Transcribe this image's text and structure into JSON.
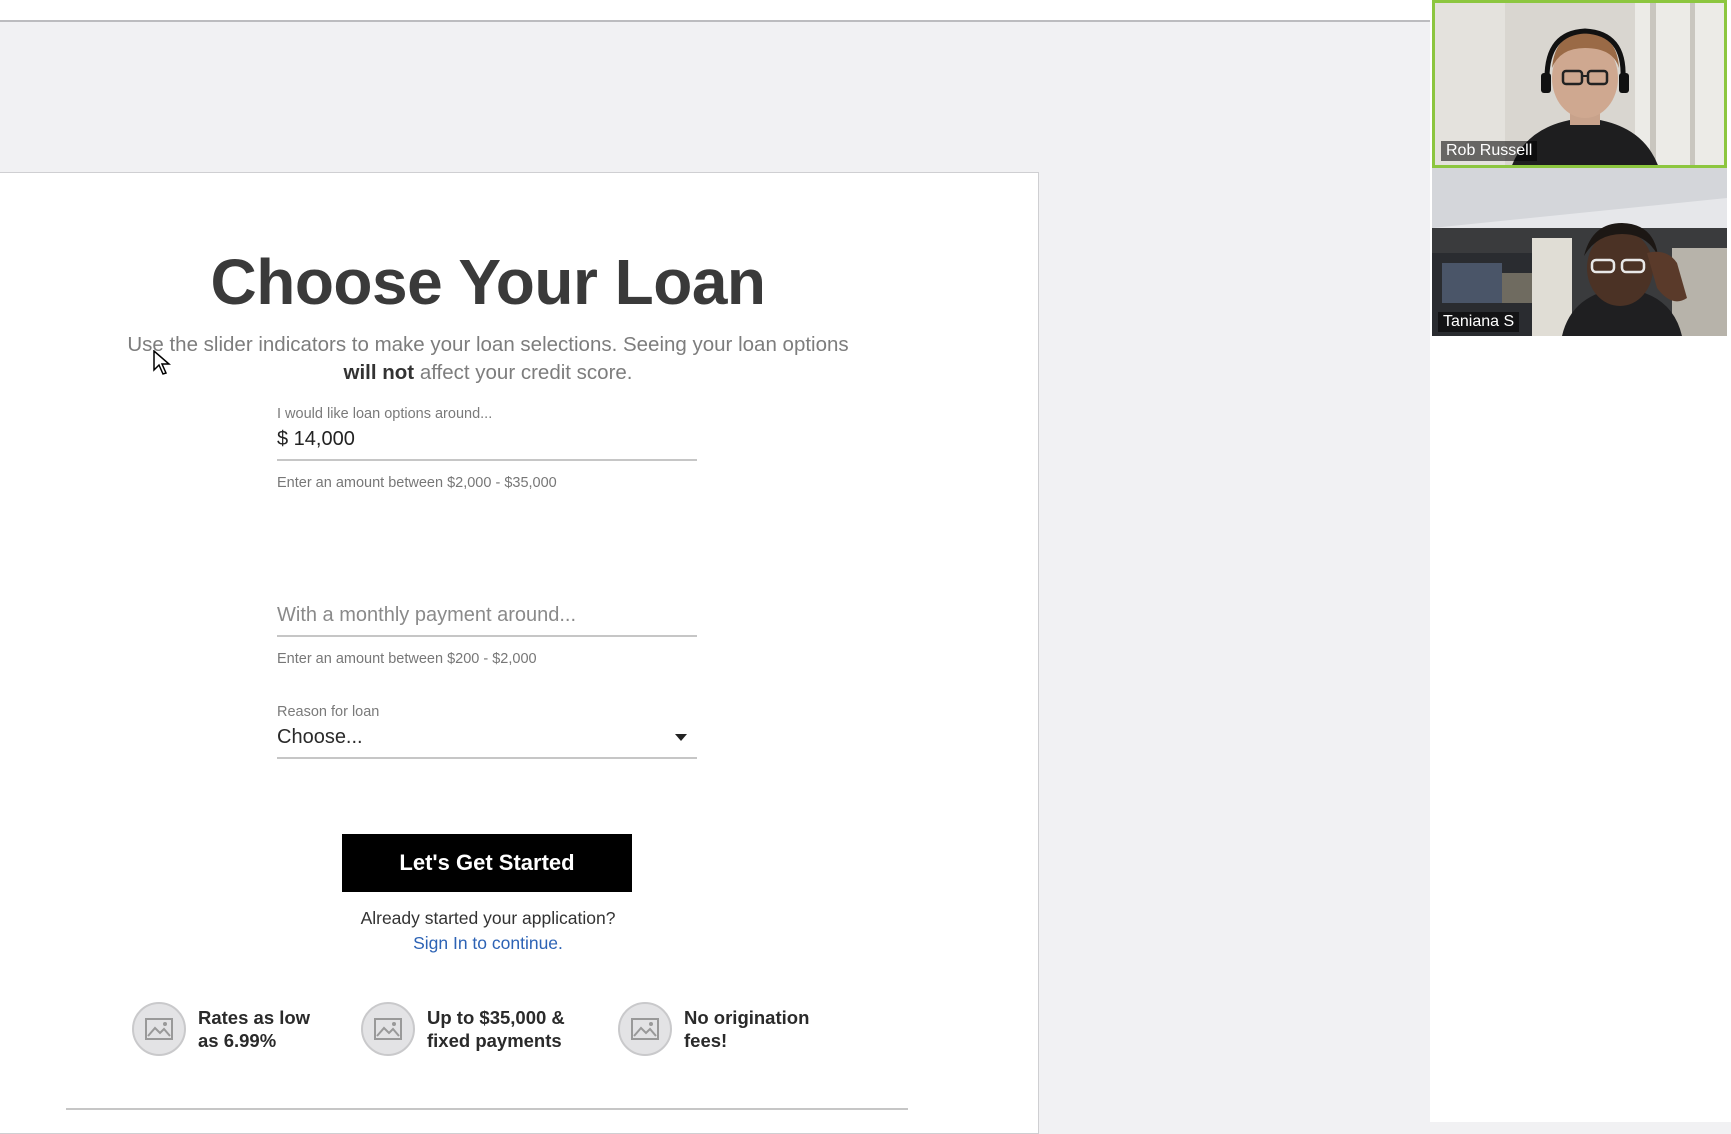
{
  "page": {
    "title": "Choose Your Loan",
    "subtitle_before": "Use the slider indicators to make your loan selections. Seeing your loan options",
    "subtitle_bold": "will not",
    "subtitle_after": "affect your credit score."
  },
  "loan_amount": {
    "label": "I would like loan options around...",
    "value": "$ 14,000",
    "hint": "Enter an amount between $2,000 - $35,000"
  },
  "monthly_payment": {
    "placeholder": "With a monthly payment around...",
    "value": "",
    "hint": "Enter an amount between $200 - $2,000"
  },
  "reason": {
    "label": "Reason for loan",
    "selected": "Choose..."
  },
  "cta": {
    "label": "Let's Get Started"
  },
  "signin": {
    "prompt": "Already started your application?",
    "link": "Sign In to continue."
  },
  "features": [
    {
      "line1": "Rates as low",
      "line2": "as 6.99%",
      "icon": "image-placeholder-icon"
    },
    {
      "line1": "Up to $35,000 &",
      "line2": "fixed payments",
      "icon": "image-placeholder-icon"
    },
    {
      "line1": "No origination",
      "line2": "fees!",
      "icon": "image-placeholder-icon"
    }
  ],
  "video_call": {
    "participants": [
      {
        "name": "Rob Russell",
        "active": true
      },
      {
        "name": "Taniana S",
        "active": false
      }
    ]
  },
  "colors": {
    "accent_link": "#2d63b5",
    "button_bg": "#000000",
    "active_speaker_border": "#8cc63f"
  }
}
